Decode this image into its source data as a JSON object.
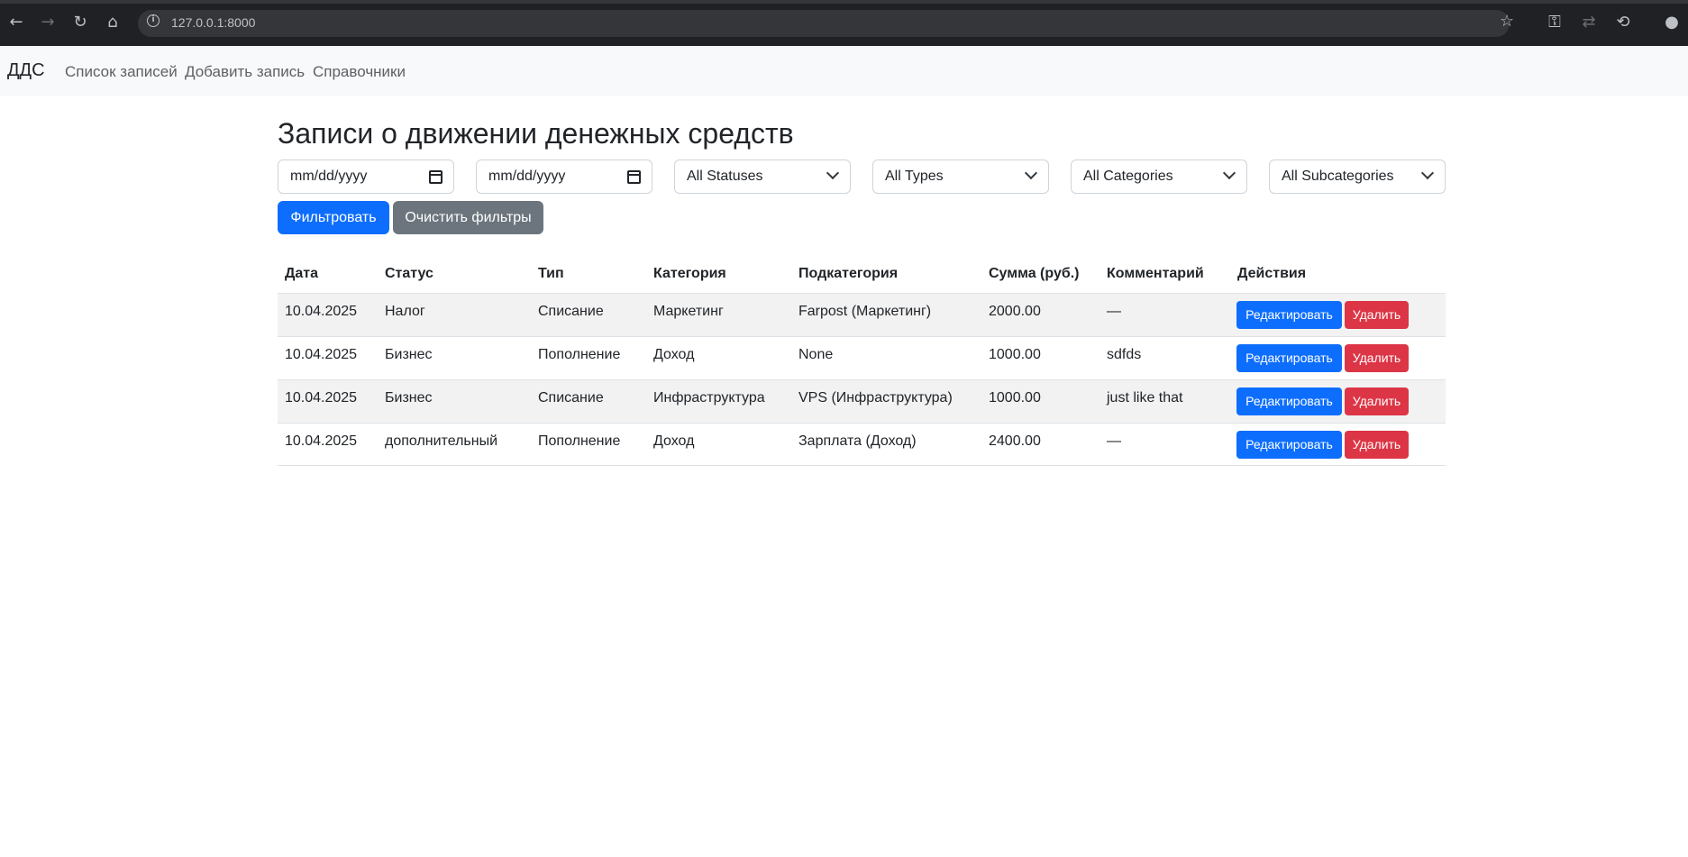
{
  "browser": {
    "url": "127.0.0.1:8000",
    "icons": [
      "back-icon",
      "forward-icon",
      "reload-icon",
      "home-icon",
      "info-icon",
      "star-icon",
      "key-icon",
      "translate-icon",
      "history-icon",
      "profile-icon"
    ]
  },
  "navbar": {
    "brand": "ДДС",
    "links": [
      "Список записей",
      "Добавить запись",
      "Справочники"
    ]
  },
  "main": {
    "title": "Записи о движении денежных средств",
    "filters": {
      "date_from": "mm/dd/yyyy",
      "date_to": "mm/dd/yyyy",
      "status": "All Statuses",
      "type": "All Types",
      "category": "All Categories",
      "subcategory": "All Subcategories"
    },
    "filter_button": "Фильтровать",
    "clear_button": "Очистить фильтры"
  },
  "table": {
    "headers": [
      "Дата",
      "Статус",
      "Тип",
      "Категория",
      "Подкатегория",
      "Сумма (руб.)",
      "Комментарий",
      "Действия"
    ],
    "rows": [
      [
        "10.04.2025",
        "Налог",
        "Списание",
        "Маркетинг",
        "Farpost (Маркетинг)",
        "2000.00",
        "—"
      ],
      [
        "10.04.2025",
        "Бизнес",
        "Пополнение",
        "Доход",
        "None",
        "1000.00",
        "sdfds"
      ],
      [
        "10.04.2025",
        "Бизнес",
        "Списание",
        "Инфраструктура",
        "VPS (Инфраструктура)",
        "1000.00",
        "just like that"
      ],
      [
        "10.04.2025",
        "дополнительный",
        "Пополнение",
        "Доход",
        "Зарплата (Доход)",
        "2400.00",
        "—"
      ]
    ],
    "edit_label": "Редактировать",
    "delete_label": "Удалить"
  },
  "colors": {
    "primary": "#0d6efd",
    "secondary": "#6c757d",
    "danger": "#dc3545",
    "navbar_bg": "#f8f9fa",
    "stripe": "#f2f2f2"
  }
}
